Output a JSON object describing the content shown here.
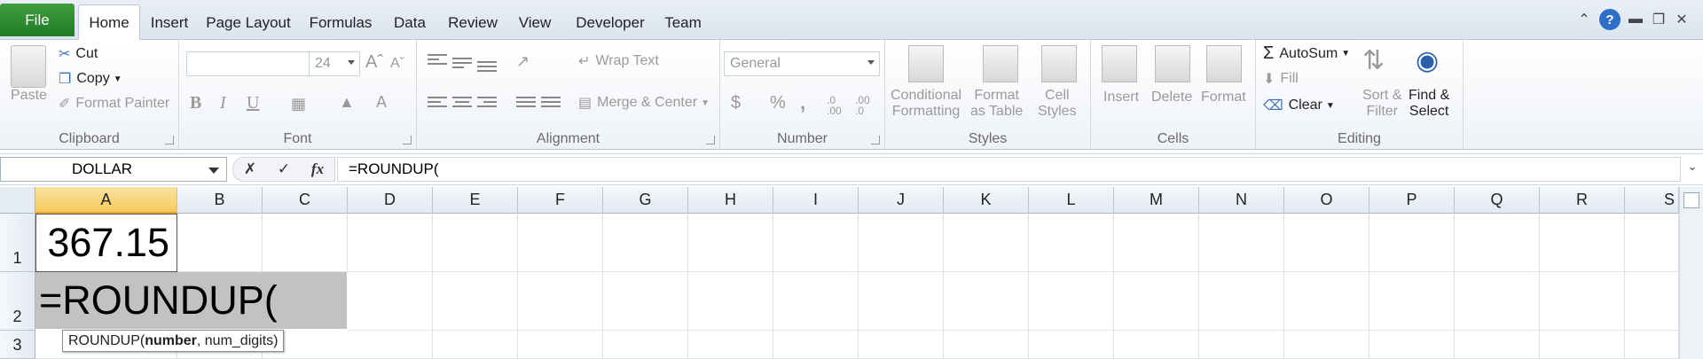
{
  "tabs": {
    "file": "File",
    "items": [
      "Home",
      "Insert",
      "Page Layout",
      "Formulas",
      "Data",
      "Review",
      "View",
      "Developer",
      "Team"
    ],
    "active": "Home"
  },
  "ribbon": {
    "clipboard": {
      "label": "Clipboard",
      "paste": "Paste",
      "cut": "Cut",
      "copy": "Copy",
      "format_painter": "Format Painter"
    },
    "font": {
      "label": "Font",
      "font_name": "",
      "font_size": "24",
      "bold": "B",
      "italic": "I",
      "underline": "U"
    },
    "alignment": {
      "label": "Alignment",
      "wrap_text": "Wrap Text",
      "merge_center": "Merge & Center"
    },
    "number": {
      "label": "Number",
      "format": "General",
      "currency": "$",
      "percent": "%",
      "comma": ",",
      "inc_decimal": ".0 .00",
      "dec_decimal": ".00 .0"
    },
    "styles": {
      "label": "Styles",
      "conditional_formatting_1": "Conditional",
      "conditional_formatting_2": "Formatting",
      "format_table_1": "Format",
      "format_table_2": "as Table",
      "cell_styles_1": "Cell",
      "cell_styles_2": "Styles"
    },
    "cells": {
      "label": "Cells",
      "insert": "Insert",
      "delete": "Delete",
      "format": "Format"
    },
    "editing": {
      "label": "Editing",
      "autosum": "AutoSum",
      "fill": "Fill",
      "clear": "Clear",
      "sort_filter_1": "Sort &",
      "sort_filter_2": "Filter",
      "find_select_1": "Find &",
      "find_select_2": "Select"
    }
  },
  "formula_bar": {
    "name_box": "DOLLAR",
    "fx": "fx",
    "formula": "=ROUNDUP("
  },
  "grid": {
    "columns": [
      "A",
      "B",
      "C",
      "D",
      "E",
      "F",
      "G",
      "H",
      "I",
      "J",
      "K",
      "L",
      "M",
      "N",
      "O",
      "P",
      "Q",
      "R",
      "S"
    ],
    "rows": [
      "1",
      "2",
      "3"
    ],
    "a1_value": "367.15",
    "a2_editing": "=ROUNDUP(",
    "tooltip_fn": "ROUNDUP(",
    "tooltip_arg1": "number",
    "tooltip_rest": ", num_digits)"
  },
  "colors": {
    "file_tab": "#1e7b23",
    "selected_col_header": "#f7c95b",
    "editing_fill": "#c2c2c2"
  }
}
